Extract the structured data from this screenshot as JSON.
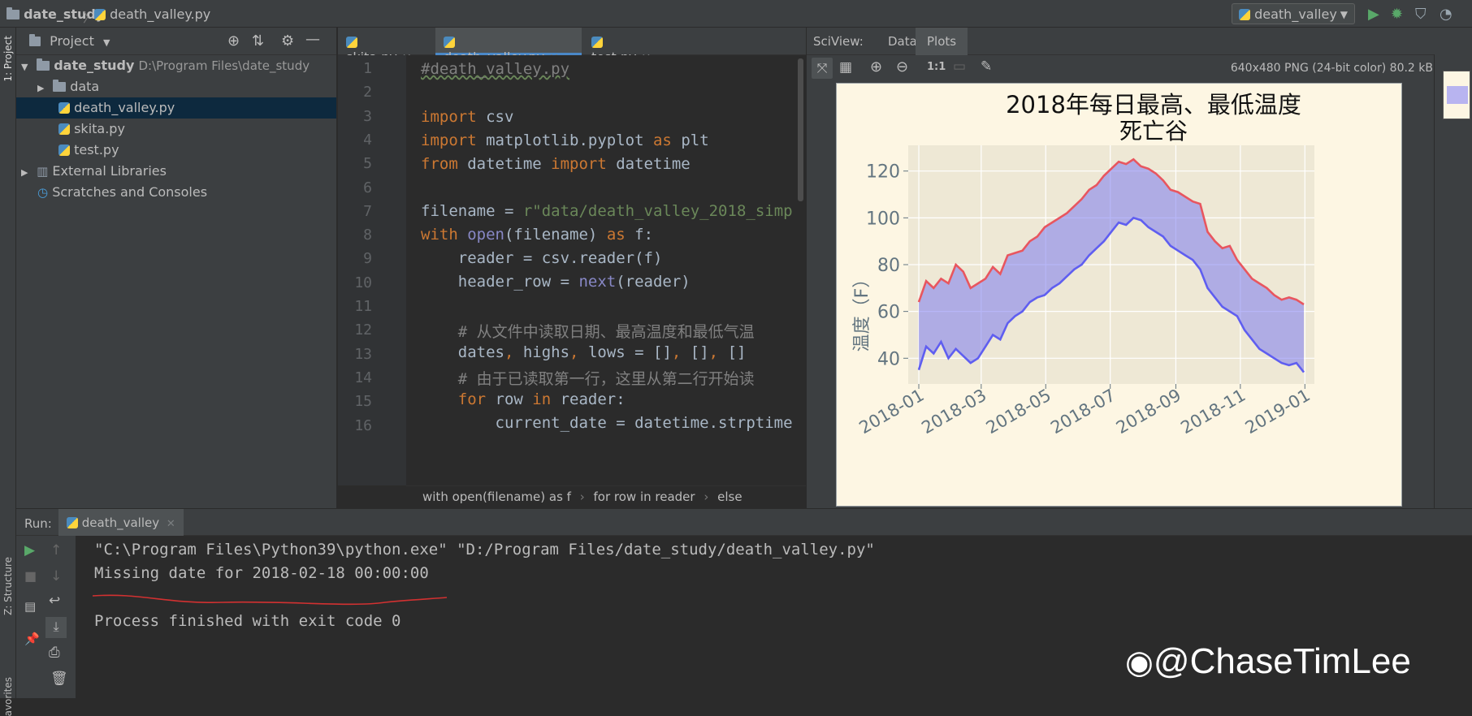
{
  "window": {
    "breadcrumb_project": "date_study",
    "breadcrumb_file": "death_valley.py",
    "run_config": "death_valley"
  },
  "left_strip": {
    "project_label": "1: Project",
    "structure_label": "Z: Structure",
    "favorites_label": "avorites"
  },
  "project_panel": {
    "title": "Project",
    "tree": [
      {
        "label": "date_study",
        "detail": "D:\\Program Files\\date_study"
      },
      {
        "label": "data"
      },
      {
        "label": "death_valley.py"
      },
      {
        "label": "skita.py"
      },
      {
        "label": "test.py"
      },
      {
        "label": "External Libraries"
      },
      {
        "label": "Scratches and Consoles"
      }
    ]
  },
  "editor": {
    "tabs": [
      {
        "label": "skita.py"
      },
      {
        "label": "death_valley.py"
      },
      {
        "label": "test.py"
      }
    ],
    "line_numbers": [
      "1",
      "2",
      "3",
      "4",
      "5",
      "6",
      "7",
      "8",
      "9",
      "10",
      "11",
      "12",
      "13",
      "14",
      "15",
      "16"
    ],
    "code": {
      "l1": "#death_valley.py",
      "l3a": "import",
      "l3b": " csv",
      "l4a": "import",
      "l4b": " matplotlib.pyplot ",
      "l4c": "as",
      "l4d": " plt",
      "l5a": "from",
      "l5b": " datetime ",
      "l5c": "import",
      "l5d": " datetime",
      "l7a": "filename = ",
      "l7b": "r\"data/death_valley_2018_simp",
      "l8a": "with ",
      "l8b": "open",
      "l8c": "(filename) ",
      "l8d": "as",
      "l8e": " f:",
      "l9": "    reader = csv.reader(f)",
      "l10a": "    header_row = ",
      "l10b": "next",
      "l10c": "(reader)",
      "l12": "    # 从文件中读取日期、最高温度和最低气温",
      "l13a": "    dates",
      "l13b": ",",
      "l13c": " highs",
      "l13d": ",",
      "l13e": " lows = []",
      "l13f": ",",
      "l13g": " []",
      "l13h": ",",
      "l13i": " []",
      "l14": "    # 由于已读取第一行，这里从第二行开始读",
      "l15a": "    for",
      "l15b": " row ",
      "l15c": "in",
      "l15d": " reader:",
      "l16": "        current_date = datetime.strptime"
    },
    "breadcrumbs": [
      "with open(filename) as f",
      "for row in reader",
      "else"
    ]
  },
  "sciview": {
    "title": "SciView:",
    "tabs": [
      "Data",
      "Plots"
    ],
    "image_info": "640x480 PNG (24-bit color) 80.2 kB",
    "zoom_label": "1:1"
  },
  "chart_data": {
    "type": "line",
    "title": "2018年每日最高、最低温度",
    "subtitle": "死亡谷",
    "ylabel": "温度（F）",
    "xlabel": "",
    "x_ticks": [
      "2018-01",
      "2018-03",
      "2018-05",
      "2018-07",
      "2018-09",
      "2018-11",
      "2019-01"
    ],
    "y_ticks": [
      "40",
      "60",
      "80",
      "100",
      "120"
    ],
    "ylim": [
      29,
      131
    ],
    "xlim": [
      "2017-12-22",
      "2019-01-10"
    ],
    "grid": true,
    "fill_between": true,
    "series": [
      {
        "color": "#e8565f",
        "points": [
          [
            "2018-01-01",
            64
          ],
          [
            "2018-01-08",
            73
          ],
          [
            "2018-01-15",
            70
          ],
          [
            "2018-01-22",
            74
          ],
          [
            "2018-01-29",
            72
          ],
          [
            "2018-02-05",
            80
          ],
          [
            "2018-02-12",
            77
          ],
          [
            "2018-02-19",
            70
          ],
          [
            "2018-02-26",
            72
          ],
          [
            "2018-03-05",
            74
          ],
          [
            "2018-03-12",
            79
          ],
          [
            "2018-03-19",
            76
          ],
          [
            "2018-03-26",
            84
          ],
          [
            "2018-04-02",
            85
          ],
          [
            "2018-04-09",
            86
          ],
          [
            "2018-04-16",
            90
          ],
          [
            "2018-04-23",
            92
          ],
          [
            "2018-04-30",
            96
          ],
          [
            "2018-05-07",
            98
          ],
          [
            "2018-05-14",
            100
          ],
          [
            "2018-05-21",
            102
          ],
          [
            "2018-05-28",
            105
          ],
          [
            "2018-06-04",
            108
          ],
          [
            "2018-06-11",
            112
          ],
          [
            "2018-06-18",
            114
          ],
          [
            "2018-06-25",
            118
          ],
          [
            "2018-07-02",
            121
          ],
          [
            "2018-07-09",
            124
          ],
          [
            "2018-07-16",
            123
          ],
          [
            "2018-07-23",
            125
          ],
          [
            "2018-07-30",
            122
          ],
          [
            "2018-08-06",
            121
          ],
          [
            "2018-08-13",
            119
          ],
          [
            "2018-08-20",
            116
          ],
          [
            "2018-08-27",
            112
          ],
          [
            "2018-09-03",
            111
          ],
          [
            "2018-09-10",
            109
          ],
          [
            "2018-09-17",
            107
          ],
          [
            "2018-09-24",
            106
          ],
          [
            "2018-10-01",
            94
          ],
          [
            "2018-10-08",
            90
          ],
          [
            "2018-10-15",
            87
          ],
          [
            "2018-10-22",
            88
          ],
          [
            "2018-10-29",
            82
          ],
          [
            "2018-11-05",
            78
          ],
          [
            "2018-11-12",
            74
          ],
          [
            "2018-11-19",
            72
          ],
          [
            "2018-11-26",
            70
          ],
          [
            "2018-12-03",
            67
          ],
          [
            "2018-12-10",
            65
          ],
          [
            "2018-12-17",
            66
          ],
          [
            "2018-12-24",
            65
          ],
          [
            "2018-12-31",
            63
          ]
        ]
      },
      {
        "color": "#5f5ef0",
        "points": [
          [
            "2018-01-01",
            35
          ],
          [
            "2018-01-08",
            45
          ],
          [
            "2018-01-15",
            42
          ],
          [
            "2018-01-22",
            47
          ],
          [
            "2018-01-29",
            40
          ],
          [
            "2018-02-05",
            44
          ],
          [
            "2018-02-12",
            41
          ],
          [
            "2018-02-19",
            38
          ],
          [
            "2018-02-26",
            40
          ],
          [
            "2018-03-05",
            45
          ],
          [
            "2018-03-12",
            50
          ],
          [
            "2018-03-19",
            48
          ],
          [
            "2018-03-26",
            55
          ],
          [
            "2018-04-02",
            58
          ],
          [
            "2018-04-09",
            60
          ],
          [
            "2018-04-16",
            64
          ],
          [
            "2018-04-23",
            66
          ],
          [
            "2018-04-30",
            67
          ],
          [
            "2018-05-07",
            70
          ],
          [
            "2018-05-14",
            72
          ],
          [
            "2018-05-21",
            75
          ],
          [
            "2018-05-28",
            78
          ],
          [
            "2018-06-04",
            80
          ],
          [
            "2018-06-11",
            84
          ],
          [
            "2018-06-18",
            87
          ],
          [
            "2018-06-25",
            90
          ],
          [
            "2018-07-02",
            94
          ],
          [
            "2018-07-09",
            98
          ],
          [
            "2018-07-16",
            97
          ],
          [
            "2018-07-23",
            100
          ],
          [
            "2018-07-30",
            99
          ],
          [
            "2018-08-06",
            96
          ],
          [
            "2018-08-13",
            94
          ],
          [
            "2018-08-20",
            92
          ],
          [
            "2018-08-27",
            88
          ],
          [
            "2018-09-03",
            86
          ],
          [
            "2018-09-10",
            84
          ],
          [
            "2018-09-17",
            82
          ],
          [
            "2018-09-24",
            78
          ],
          [
            "2018-10-01",
            70
          ],
          [
            "2018-10-08",
            66
          ],
          [
            "2018-10-15",
            62
          ],
          [
            "2018-10-22",
            60
          ],
          [
            "2018-10-29",
            58
          ],
          [
            "2018-11-05",
            52
          ],
          [
            "2018-11-12",
            48
          ],
          [
            "2018-11-19",
            44
          ],
          [
            "2018-11-26",
            42
          ],
          [
            "2018-12-03",
            40
          ],
          [
            "2018-12-10",
            38
          ],
          [
            "2018-12-17",
            37
          ],
          [
            "2018-12-24",
            38
          ],
          [
            "2018-12-31",
            34
          ]
        ]
      }
    ]
  },
  "run_panel": {
    "label": "Run:",
    "tab": "death_valley",
    "lines": [
      "\"C:\\Program Files\\Python39\\python.exe\" \"D:/Program Files/date_study/death_valley.py\"",
      "Missing date for 2018-02-18 00:00:00",
      "Process finished with exit code 0"
    ]
  },
  "watermark": "@ChaseTimLee"
}
